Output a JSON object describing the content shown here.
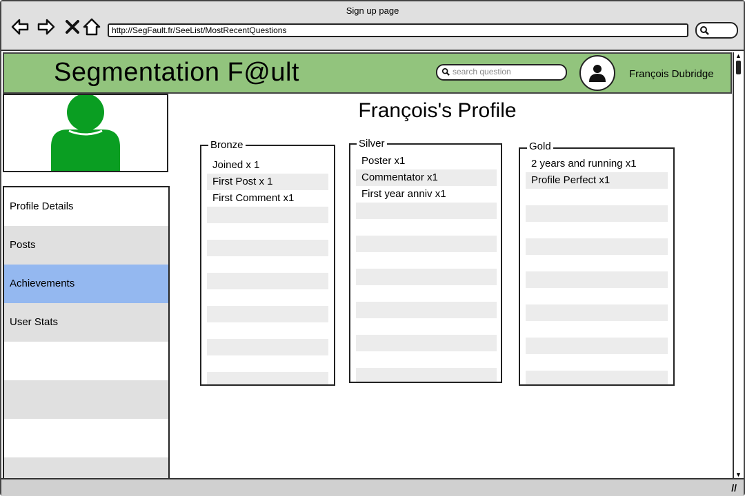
{
  "browser": {
    "window_title": "Sign up page",
    "url": "http://SegFault.fr/SeeList/MostRecentQuestions"
  },
  "header": {
    "logo": "Segmentation F@ult",
    "search_placeholder": "search question",
    "user_name": "François Dubridge"
  },
  "sidebar": {
    "items": [
      {
        "label": "Profile Details"
      },
      {
        "label": "Posts"
      },
      {
        "label": "Achievements",
        "selected": true
      },
      {
        "label": "User Stats"
      }
    ]
  },
  "profile": {
    "title": "François's Profile"
  },
  "achievements": {
    "bronze": {
      "title": "Bronze",
      "items": [
        "Joined  x 1",
        "First Post x 1",
        "First Comment x1"
      ]
    },
    "silver": {
      "title": "Silver",
      "items": [
        "Poster x1",
        "Commentator x1",
        "First year anniv x1"
      ]
    },
    "gold": {
      "title": "Gold",
      "items": [
        "2 years and running x1",
        "Profile Perfect x1"
      ]
    }
  },
  "colors": {
    "header_bg": "#92c47d",
    "avatar_green": "#0a9e22",
    "selected_item": "#94b8f0"
  }
}
